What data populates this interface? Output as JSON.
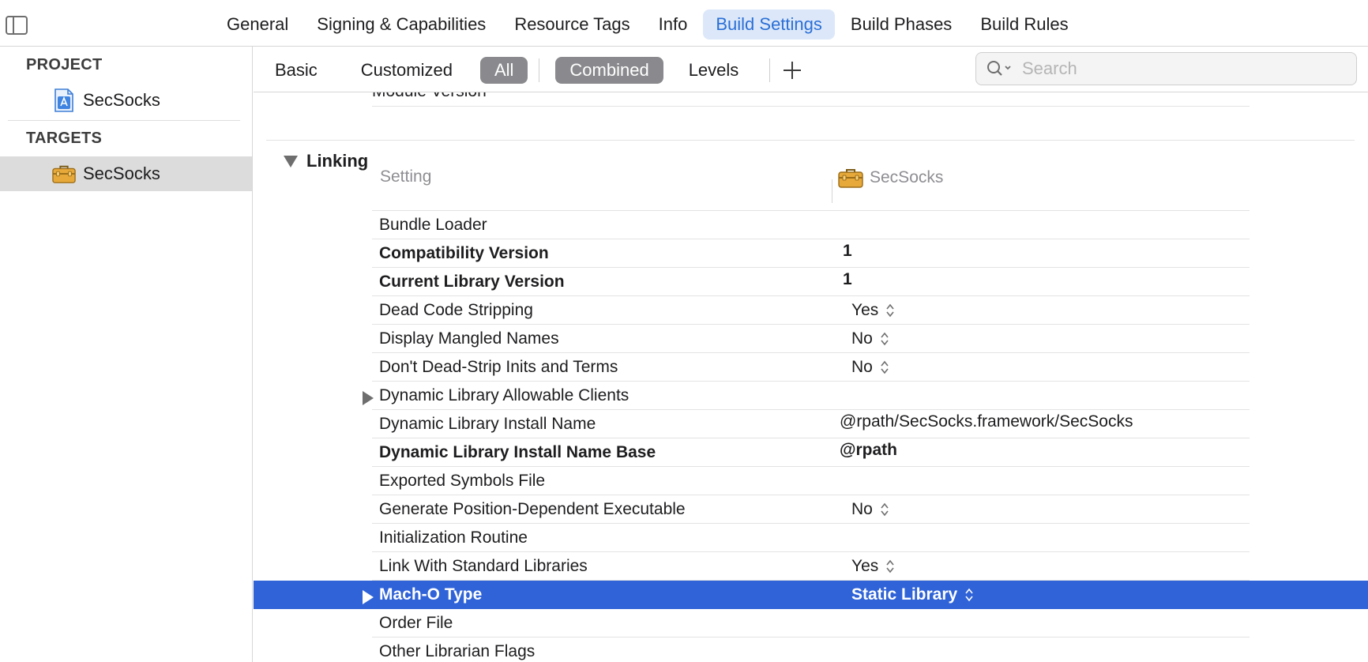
{
  "top_tabs": [
    {
      "label": "General",
      "active": false
    },
    {
      "label": "Signing & Capabilities",
      "active": false
    },
    {
      "label": "Resource Tags",
      "active": false
    },
    {
      "label": "Info",
      "active": false
    },
    {
      "label": "Build Settings",
      "active": true
    },
    {
      "label": "Build Phases",
      "active": false
    },
    {
      "label": "Build Rules",
      "active": false
    }
  ],
  "sidebar": {
    "project_header": "PROJECT",
    "project_item": "SecSocks",
    "targets_header": "TARGETS",
    "target_item": "SecSocks"
  },
  "filters": {
    "basic": "Basic",
    "customized": "Customized",
    "all": "All",
    "combined": "Combined",
    "levels": "Levels"
  },
  "search": {
    "placeholder": "Search"
  },
  "main": {
    "partial_row": "Module Version",
    "section_title": "Linking",
    "col_setting": "Setting",
    "col_target": "SecSocks",
    "rows": [
      {
        "name": "Bundle Loader",
        "value": ""
      },
      {
        "name": "Compatibility Version",
        "value": "1"
      },
      {
        "name": "Current Library Version",
        "value": "1"
      },
      {
        "name": "Dead Code Stripping",
        "value": "Yes"
      },
      {
        "name": "Display Mangled Names",
        "value": "No"
      },
      {
        "name": "Don't Dead-Strip Inits and Terms",
        "value": "No"
      },
      {
        "name": "Dynamic Library Allowable Clients",
        "value": ""
      },
      {
        "name": "Dynamic Library Install Name",
        "value": "@rpath/SecSocks.framework/SecSocks"
      },
      {
        "name": "Dynamic Library Install Name Base",
        "value": "@rpath"
      },
      {
        "name": "Exported Symbols File",
        "value": ""
      },
      {
        "name": "Generate Position-Dependent Executable",
        "value": "No"
      },
      {
        "name": "Initialization Routine",
        "value": ""
      },
      {
        "name": "Link With Standard Libraries",
        "value": "Yes"
      },
      {
        "name": "Mach-O Type",
        "value": "Static Library"
      },
      {
        "name": "Order File",
        "value": ""
      },
      {
        "name": "Other Librarian Flags",
        "value": ""
      }
    ]
  },
  "colors": {
    "accent": "#2a6fd6",
    "selection": "#2f63d7",
    "pill": "#8a8a8e"
  }
}
